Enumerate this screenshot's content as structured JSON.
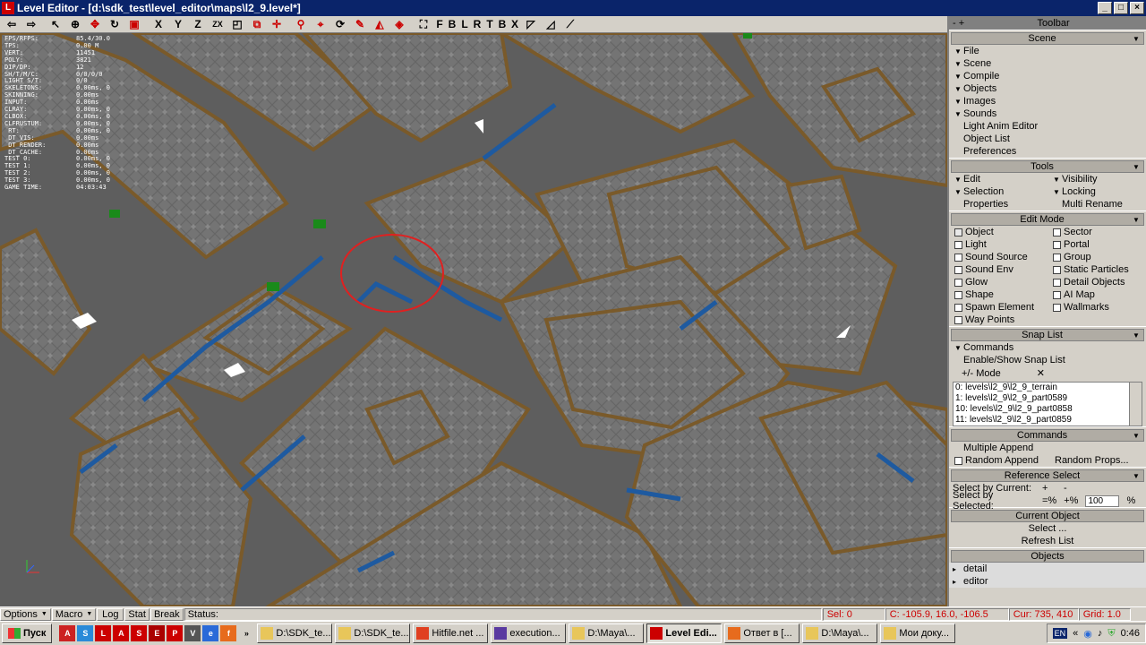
{
  "window": {
    "title": "Level Editor - [d:\\sdk_test\\level_editor\\maps\\l2_9.level*]",
    "app_icon": "L",
    "minimize": "_",
    "maximize": "□",
    "close": "×"
  },
  "toolbar": {
    "axis_buttons": [
      "X",
      "Y",
      "Z",
      "ZX"
    ],
    "snap_buttons": [
      "F",
      "B",
      "L",
      "R",
      "T",
      "B",
      "X"
    ]
  },
  "stats": [
    {
      "k": "FPS/RFPS:",
      "v": "85.4/30.0"
    },
    {
      "k": "TPS:",
      "v": "0.00 M"
    },
    {
      "k": "VERT:",
      "v": "11451"
    },
    {
      "k": "POLY:",
      "v": "3821"
    },
    {
      "k": "DIP/DP:",
      "v": "12"
    },
    {
      "k": "SH/T/M/C:",
      "v": "0/0/0/0"
    },
    {
      "k": "LIGHT S/T:",
      "v": "0/0"
    },
    {
      "k": "SKELETONS:",
      "v": "0.00ms, 0"
    },
    {
      "k": "SKINNING:",
      "v": "0.00ms"
    },
    {
      "k": "",
      "v": ""
    },
    {
      "k": "INPUT:",
      "v": "0.00ms"
    },
    {
      "k": "CLRAY:",
      "v": "0.00ms, 0"
    },
    {
      "k": "CLBOX:",
      "v": "0.00ms, 0"
    },
    {
      "k": "CLFRUSTUM:",
      "v": "0.00ms, 0"
    },
    {
      "k": "",
      "v": ""
    },
    {
      "k": " RT:",
      "v": "0.00ms, 0"
    },
    {
      "k": " DT_VIS:",
      "v": "0.00ms"
    },
    {
      "k": " DT_RENDER:",
      "v": "0.00ms"
    },
    {
      "k": " DT_CACHE:",
      "v": "0.00ms"
    },
    {
      "k": "",
      "v": ""
    },
    {
      "k": "TEST 0:",
      "v": "0.00ms, 0"
    },
    {
      "k": "TEST 1:",
      "v": "0.00ms, 0"
    },
    {
      "k": "TEST 2:",
      "v": "0.00ms, 0"
    },
    {
      "k": "TEST 3:",
      "v": "0.00ms, 0"
    },
    {
      "k": "",
      "v": ""
    },
    {
      "k": "GAME TIME:",
      "v": "04:03:43"
    }
  ],
  "panel": {
    "title": "Toolbar",
    "title_left": "- +",
    "scene": {
      "header": "Scene",
      "items": [
        "File",
        "Scene",
        "Compile",
        "Objects",
        "Images",
        "Sounds"
      ],
      "links": [
        "Light Anim Editor",
        "Object List",
        "Preferences"
      ]
    },
    "tools": {
      "header": "Tools",
      "left": [
        "Edit",
        "Selection"
      ],
      "right": [
        "Visibility",
        "Locking"
      ],
      "bottom_left": "Properties",
      "bottom_right": "Multi Rename"
    },
    "edit_mode": {
      "header": "Edit Mode",
      "left": [
        "Object",
        "Light",
        "Sound Source",
        "Sound Env",
        "Glow",
        "Shape",
        "Spawn Element",
        "Way Points"
      ],
      "right": [
        "Sector",
        "Portal",
        "Group",
        "Static Particles",
        "Detail Objects",
        "AI Map",
        "Wallmarks",
        ""
      ]
    },
    "snap_list": {
      "header": "Snap List",
      "commands": "Commands",
      "enable": "Enable/Show Snap List",
      "mode_label": "+/-  Mode",
      "mode_x": "✕",
      "entries": [
        "0: levels\\l2_9\\l2_9_terrain",
        "1: levels\\l2_9\\l2_9_part0589",
        "10: levels\\l2_9\\l2_9_part0858",
        "11: levels\\l2_9\\l2_9_part0859"
      ]
    },
    "commands": {
      "header": "Commands",
      "multiple": "Multiple Append",
      "random": "Random Append",
      "props": "Random Props..."
    },
    "ref_select": {
      "header": "Reference Select",
      "current": "Select by Current:",
      "plus": "+",
      "minus": "-",
      "selected": "Select by Selected:",
      "eq_minus": "=%",
      "eq_plus": "+%",
      "value": "100",
      "pct": "%"
    },
    "current_object": {
      "header": "Current Object",
      "select": "Select ...",
      "refresh": "Refresh List"
    },
    "objects": {
      "header": "Objects",
      "items": [
        "detail",
        "editor"
      ]
    }
  },
  "statusbar": {
    "options": "Options",
    "macro": "Macro",
    "log": "Log",
    "stat": "Stat",
    "break": "Break",
    "status": "Status:",
    "sel": "Sel: 0",
    "coords": "C: -105.9, 16.0, -106.5",
    "cur": "Cur: 735, 410",
    "grid": "Grid: 1.0"
  },
  "taskbar": {
    "start": "Пуск",
    "tasks": [
      "D:\\SDK_te...",
      "D:\\SDK_te...",
      "Hitfile.net ...",
      "execution...",
      "D:\\Maya\\...",
      "Level Edi...",
      "Ответ в [...",
      "D:\\Maya\\...",
      "Мои доку..."
    ],
    "active": 5,
    "lang": "EN",
    "chev": "«",
    "clock": "0:46"
  }
}
